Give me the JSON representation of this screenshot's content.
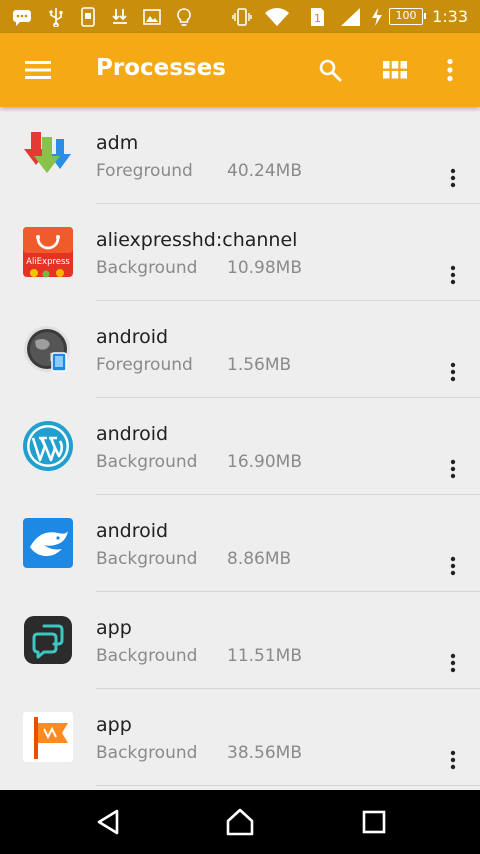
{
  "status_bar": {
    "time": "1:33",
    "battery_level": "100"
  },
  "app_bar": {
    "title": "Processes",
    "menu_icon": "hamburger-menu-icon",
    "search_icon": "search-icon",
    "grid_icon": "grid-view-icon",
    "overflow_icon": "more-vertical-icon"
  },
  "processes": [
    {
      "name": "adm",
      "state": "Foreground",
      "memory": "40.24MB",
      "icon": "adm-download-icon"
    },
    {
      "name": "aliexpresshd:channel",
      "state": "Background",
      "memory": "10.98MB",
      "icon": "aliexpress-icon",
      "icon_text": "AliExpress"
    },
    {
      "name": "android",
      "state": "Foreground",
      "memory": "1.56MB",
      "icon": "globe-phone-icon"
    },
    {
      "name": "android",
      "state": "Background",
      "memory": "16.90MB",
      "icon": "wordpress-icon"
    },
    {
      "name": "android",
      "state": "Background",
      "memory": "8.86MB",
      "icon": "blue-bird-icon"
    },
    {
      "name": "app",
      "state": "Background",
      "memory": "11.51MB",
      "icon": "chat-bubbles-icon"
    },
    {
      "name": "app",
      "state": "Background",
      "memory": "38.56MB",
      "icon": "orange-flag-icon"
    }
  ],
  "colors": {
    "status_bar": "#c98f0c",
    "app_bar": "#f5aa15",
    "background": "#eeeeee"
  }
}
